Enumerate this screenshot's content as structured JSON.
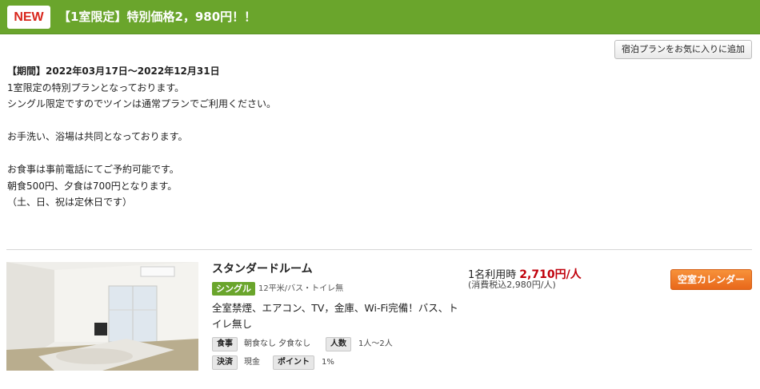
{
  "plan": {
    "new_badge": "NEW",
    "title": "【1室限定】特別価格2，980円！！"
  },
  "favorite_button": "宿泊プランをお気に入りに追加",
  "description": {
    "period": "【期間】2022年03月17日～2022年12月31日",
    "lines": [
      "1室限定の特別プランとなっております。",
      "シングル限定ですのでツインは通常プランでご利用ください。",
      "",
      "お手洗い、浴場は共同となっております。",
      "",
      "お食事は事前電話にてご予約可能です。",
      "朝食500円、夕食は700円となります。",
      "（土、日、祝は定休日です）"
    ]
  },
  "room": {
    "name": "スタンダードルーム",
    "type": "シングル",
    "size": "12平米/バス・トイレ無",
    "features": "全室禁煙、エアコン、TV，金庫、Wi-Fi完備！バス、トイレ無し",
    "meal_label": "食事",
    "meal_value": "朝食なし 夕食なし",
    "people_label": "人数",
    "people_value": "1人〜2人",
    "payment_label": "決済",
    "payment_value": "現金",
    "points_label": "ポイント",
    "points_value": "1%"
  },
  "price": {
    "label": "1名利用時",
    "value": "2,710円/人",
    "tax_note": "(消費税込2,980円/人)"
  },
  "calendar_button": "空室カレンダー",
  "colors": {
    "header_green": "#6aa52c",
    "new_red": "#d8261c",
    "price_red": "#c0000b",
    "calendar_orange": "#f07d2a"
  }
}
